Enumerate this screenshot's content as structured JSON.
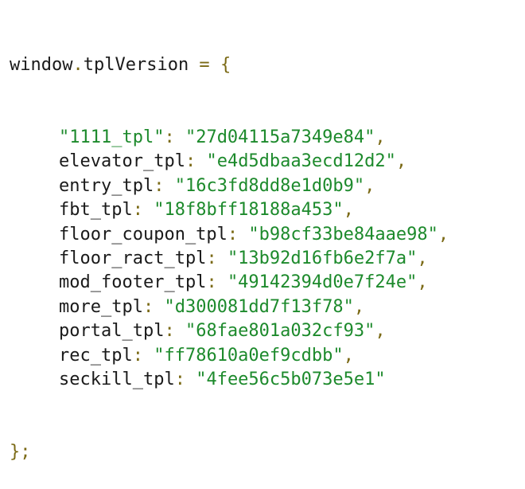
{
  "colors": {
    "identifier": "#1a1a1a",
    "string": "#1d8a2c",
    "punctuation": "#7b6a16",
    "background": "#ffffff"
  },
  "code": {
    "object": "window",
    "dot": ".",
    "property": "tplVersion",
    "assign": " = ",
    "open_brace": "{",
    "close": "};",
    "entries": [
      {
        "key": "\"1111_tpl\"",
        "value": "\"27d04115a7349e84\"",
        "comma": ","
      },
      {
        "key": "elevator_tpl",
        "value": "\"e4d5dbaa3ecd12d2\"",
        "comma": ","
      },
      {
        "key": "entry_tpl",
        "value": "\"16c3fd8dd8e1d0b9\"",
        "comma": ","
      },
      {
        "key": "fbt_tpl",
        "value": "\"18f8bff18188a453\"",
        "comma": ","
      },
      {
        "key": "floor_coupon_tpl",
        "value": "\"b98cf33be84aae98\"",
        "comma": ","
      },
      {
        "key": "floor_ract_tpl",
        "value": "\"13b92d16fb6e2f7a\"",
        "comma": ","
      },
      {
        "key": "mod_footer_tpl",
        "value": "\"49142394d0e7f24e\"",
        "comma": ","
      },
      {
        "key": "more_tpl",
        "value": "\"d300081dd7f13f78\"",
        "comma": ","
      },
      {
        "key": "portal_tpl",
        "value": "\"68fae801a032cf93\"",
        "comma": ","
      },
      {
        "key": "rec_tpl",
        "value": "\"ff78610a0ef9cdbb\"",
        "comma": ","
      },
      {
        "key": "seckill_tpl",
        "value": "\"4fee56c5b073e5e1\"",
        "comma": ""
      }
    ]
  }
}
